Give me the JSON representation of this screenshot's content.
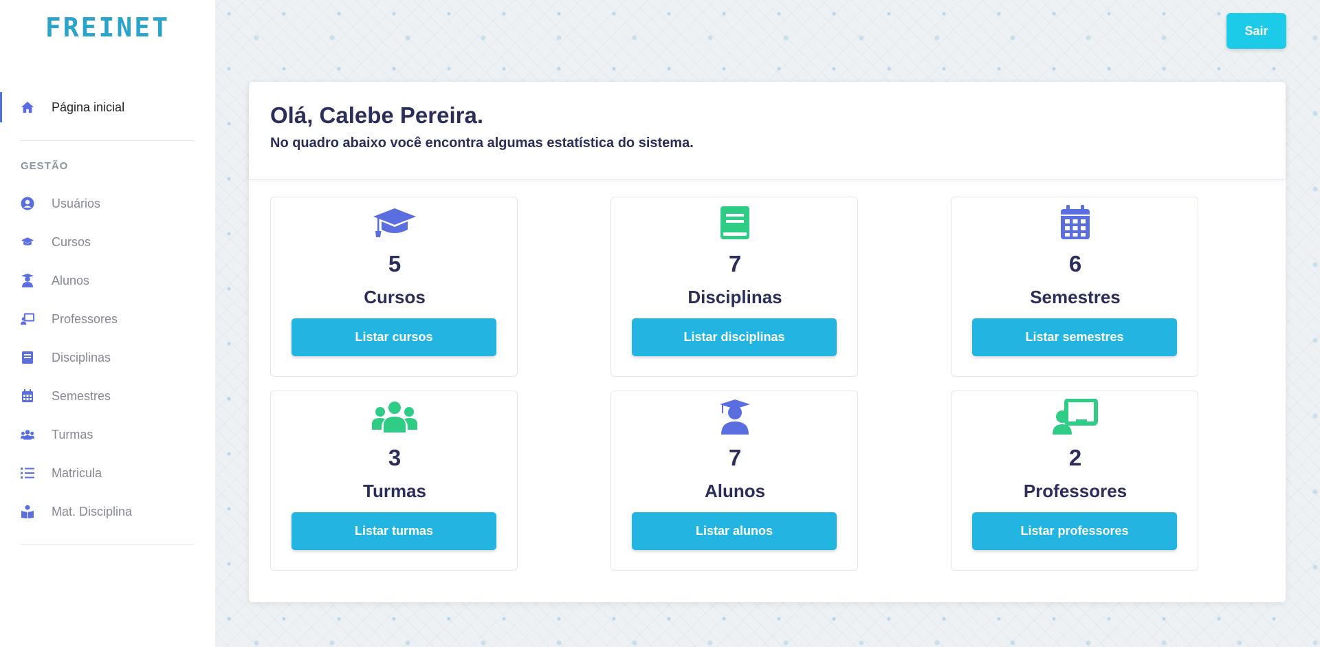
{
  "brand": "FREINET",
  "logout_label": "Sair",
  "sidebar": {
    "home": {
      "label": "Página inicial",
      "icon": "home-icon"
    },
    "section_label": "GESTÃO",
    "items": [
      {
        "label": "Usuários",
        "icon": "user-circle-icon"
      },
      {
        "label": "Cursos",
        "icon": "graduation-cap-icon"
      },
      {
        "label": "Alunos",
        "icon": "student-icon"
      },
      {
        "label": "Professores",
        "icon": "teacher-board-icon"
      },
      {
        "label": "Disciplinas",
        "icon": "book-icon"
      },
      {
        "label": "Semestres",
        "icon": "calendar-icon"
      },
      {
        "label": "Turmas",
        "icon": "users-icon"
      },
      {
        "label": "Matricula",
        "icon": "list-icon"
      },
      {
        "label": "Mat. Disciplina",
        "icon": "book-reader-icon"
      }
    ]
  },
  "main": {
    "greeting": "Olá, Calebe Pereira.",
    "subtitle": "No quadro abaixo você encontra algumas estatística do sistema.",
    "cards": [
      {
        "count": "5",
        "title": "Cursos",
        "button": "Listar cursos",
        "icon": "graduation-cap-icon",
        "color": "#5a6ee0"
      },
      {
        "count": "7",
        "title": "Disciplinas",
        "button": "Listar disciplinas",
        "icon": "book-icon",
        "color": "#2ecc85"
      },
      {
        "count": "6",
        "title": "Semestres",
        "button": "Listar semestres",
        "icon": "calendar-icon",
        "color": "#5a6ee0"
      },
      {
        "count": "3",
        "title": "Turmas",
        "button": "Listar turmas",
        "icon": "users-icon",
        "color": "#2ecc85"
      },
      {
        "count": "7",
        "title": "Alunos",
        "button": "Listar alunos",
        "icon": "student-icon",
        "color": "#5a6ee0"
      },
      {
        "count": "2",
        "title": "Professores",
        "button": "Listar professores",
        "icon": "teacher-board-icon",
        "color": "#2ecc85"
      }
    ]
  },
  "colors": {
    "accent": "#22b5e2",
    "logout": "#1ccbe8",
    "nav_icon": "#5a6ee0",
    "text_dark": "#2b2d5a"
  }
}
